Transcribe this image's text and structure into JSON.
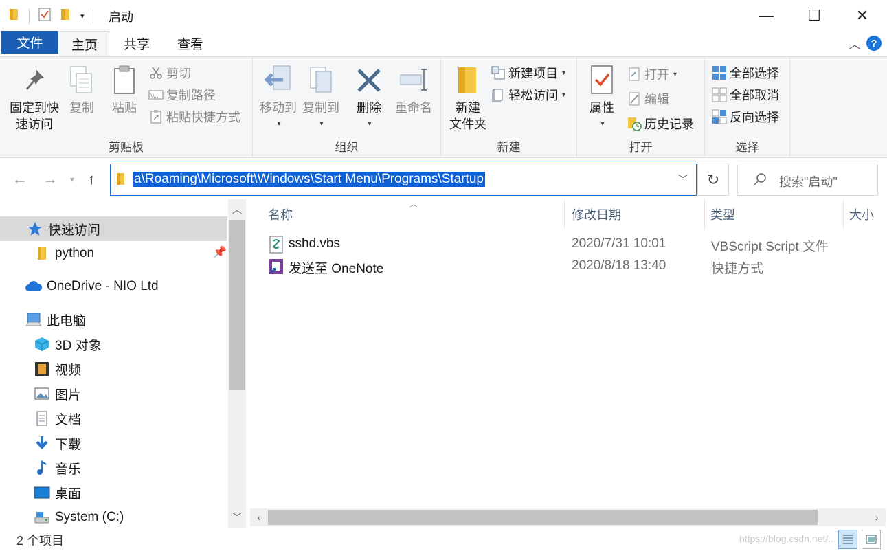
{
  "window": {
    "title": "启动",
    "minimize": "—",
    "maximize": "☐",
    "close": "✕"
  },
  "tabs": {
    "file": "文件",
    "home": "主页",
    "share": "共享",
    "view": "查看"
  },
  "help": "?",
  "ribbon": {
    "clipboard": {
      "label": "剪贴板",
      "pin_line1": "固定到快",
      "pin_line2": "速访问",
      "copy": "复制",
      "paste": "粘贴",
      "cut": "剪切",
      "copy_path": "复制路径",
      "paste_shortcut": "粘贴快捷方式"
    },
    "organize": {
      "label": "组织",
      "move_to": "移动到",
      "copy_to": "复制到",
      "delete": "删除",
      "rename": "重命名"
    },
    "new": {
      "label": "新建",
      "new_folder_line1": "新建",
      "new_folder_line2": "文件夹",
      "new_item": "新建项目",
      "easy_access": "轻松访问"
    },
    "open": {
      "label": "打开",
      "properties": "属性",
      "open": "打开",
      "edit": "编辑",
      "history": "历史记录"
    },
    "select": {
      "label": "选择",
      "select_all": "全部选择",
      "select_none": "全部取消",
      "invert": "反向选择"
    }
  },
  "address": {
    "path": "a\\Roaming\\Microsoft\\Windows\\Start Menu\\Programs\\Startup"
  },
  "search": {
    "placeholder": "搜索\"启动\""
  },
  "nav": {
    "quick_access": "快速访问",
    "python": "python",
    "onedrive": "OneDrive - NIO Ltd",
    "this_pc": "此电脑",
    "objects3d": "3D 对象",
    "videos": "视频",
    "pictures": "图片",
    "documents": "文档",
    "downloads": "下载",
    "music": "音乐",
    "desktop": "桌面",
    "system_c": "System (C:)"
  },
  "columns": {
    "name": "名称",
    "modified": "修改日期",
    "type": "类型",
    "size": "大小"
  },
  "files": [
    {
      "name": "sshd.vbs",
      "modified": "2020/7/31 10:01",
      "type": "VBScript Script 文件"
    },
    {
      "name": "发送至 OneNote",
      "modified": "2020/8/18 13:40",
      "type": "快捷方式"
    }
  ],
  "status": {
    "count": "2 个项目",
    "watermark": "https://blog.csdn.net/..."
  },
  "colors": {
    "accent": "#1a5fb4",
    "selection": "#0f5fd5",
    "folder": "#f4c542"
  }
}
